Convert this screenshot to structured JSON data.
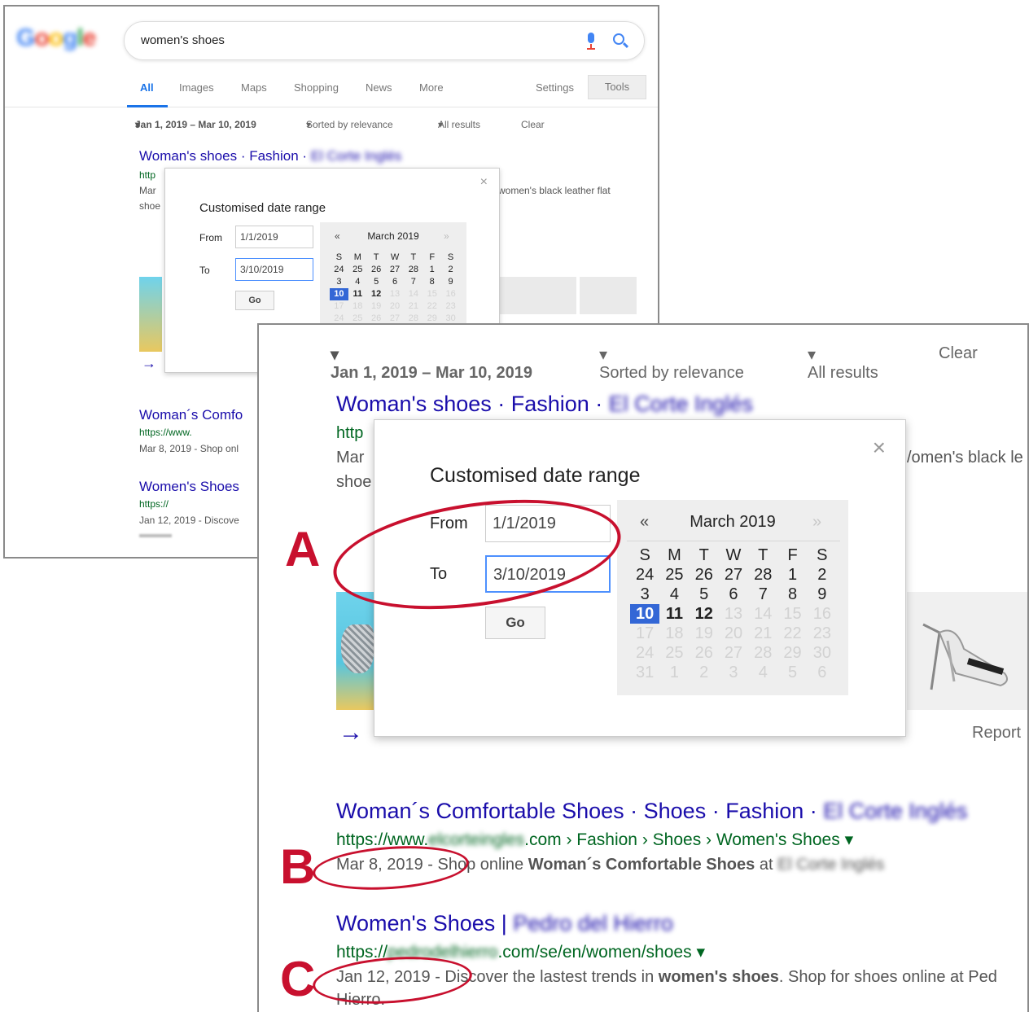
{
  "search": {
    "query": "women's shoes",
    "logo": [
      "G",
      "o",
      "o",
      "g",
      "l",
      "e"
    ],
    "logo_colors": [
      "#4285f4",
      "#ea4335",
      "#fbbc05",
      "#4285f4",
      "#34a853",
      "#ea4335"
    ]
  },
  "nav": {
    "tabs": [
      "All",
      "Images",
      "Maps",
      "Shopping",
      "News",
      "More"
    ],
    "settings": "Settings",
    "tools": "Tools"
  },
  "filters": {
    "date_range": "Jan 1, 2019 – Mar 10, 2019",
    "sort": "Sorted by relevance",
    "results": "All results",
    "clear": "Clear"
  },
  "result1": {
    "title": "Woman's shoes · Fashion · ",
    "title_blurred": "El Corte Inglés",
    "url_fragment": "http",
    "date_fragment": "Mar",
    "snippet_fragment": "shoe",
    "snippet_right": "women's black leather flat",
    "snippet_right_large": "/omen's black le",
    "report": "Report"
  },
  "dialog": {
    "title": "Customised date range",
    "close": "×",
    "from_label": "From",
    "from_value": "1/1/2019",
    "to_label": "To",
    "to_value": "3/10/2019",
    "go": "Go"
  },
  "calendar": {
    "month": "March 2019",
    "prev": "«",
    "next": "»",
    "weekdays": [
      "S",
      "M",
      "T",
      "W",
      "T",
      "F",
      "S"
    ],
    "weeks": [
      [
        "24",
        "25",
        "26",
        "27",
        "28",
        "1",
        "2"
      ],
      [
        "3",
        "4",
        "5",
        "6",
        "7",
        "8",
        "9"
      ],
      [
        "10",
        "11",
        "12",
        "13",
        "14",
        "15",
        "16"
      ],
      [
        "17",
        "18",
        "19",
        "20",
        "21",
        "22",
        "23"
      ],
      [
        "24",
        "25",
        "26",
        "27",
        "28",
        "29",
        "30"
      ],
      [
        "31",
        "1",
        "2",
        "3",
        "4",
        "5",
        "6"
      ]
    ],
    "selected_day": "10"
  },
  "result2": {
    "title": "Woman´s Comfortable Shoes · Shoes · Fashion · ",
    "title_blurred": "El Corte Inglés",
    "url_prefix": "https://www.",
    "url_blurred": "elcorteingles",
    "url_suffix": ".com › Fashion › Shoes › Women's Shoes",
    "small_title": "Woman´s Comfo",
    "small_url": "https://www.",
    "small_date": "Mar 8, 2019 - Shop onl",
    "date": "Mar 8, 2019",
    "snippet": " - Shop online ",
    "snippet_bold": "Woman´s Comfortable Shoes",
    "snippet_end": " at "
  },
  "result3": {
    "title": "Women's Shoes | ",
    "title_blurred": "Pedro del Hierro",
    "url_prefix": "https://",
    "url_blurred": "pedrodelhierro",
    "url_suffix": ".com/se/en/women/shoes",
    "small_title": "Women's Shoes",
    "small_url": "https://",
    "small_date": "Jan 12, 2019 - Discove",
    "date": "Jan 12, 2019",
    "snippet": " - Discover the lastest trends in ",
    "snippet_bold": "women's shoes",
    "snippet_end": ". Shop for shoes online at Ped",
    "snippet_line2": "Hierro."
  },
  "annotations": [
    "A",
    "B",
    "C"
  ],
  "colors": {
    "annotation": "#c8102e",
    "link": "#1a0dab",
    "url": "#006621",
    "accent": "#3367d6"
  }
}
